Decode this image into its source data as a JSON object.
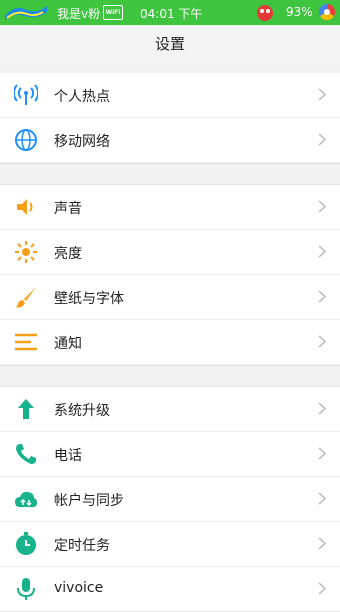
{
  "status_bar": {
    "carrier": "我是v粉",
    "wifi": "WiFi",
    "time": "04:01 下午",
    "battery": "93%"
  },
  "header": {
    "title": "设置"
  },
  "groups": [
    [
      {
        "label": "个人热点",
        "icon": "hotspot-icon"
      },
      {
        "label": "移动网络",
        "icon": "globe-icon"
      }
    ],
    [
      {
        "label": "声音",
        "icon": "speaker-icon"
      },
      {
        "label": "亮度",
        "icon": "sun-icon"
      },
      {
        "label": "壁纸与字体",
        "icon": "brush-icon"
      },
      {
        "label": "通知",
        "icon": "notification-icon"
      }
    ],
    [
      {
        "label": "系统升级",
        "icon": "arrow-up-icon"
      },
      {
        "label": "电话",
        "icon": "phone-icon"
      },
      {
        "label": "帐户与同步",
        "icon": "cloud-sync-icon"
      },
      {
        "label": "定时任务",
        "icon": "timer-icon"
      },
      {
        "label": "vivoice",
        "icon": "microphone-icon"
      }
    ]
  ],
  "colors": {
    "status_bar": "#3ec43e",
    "blue": "#1e90ff",
    "orange": "#f5a018",
    "teal": "#17b38c"
  }
}
